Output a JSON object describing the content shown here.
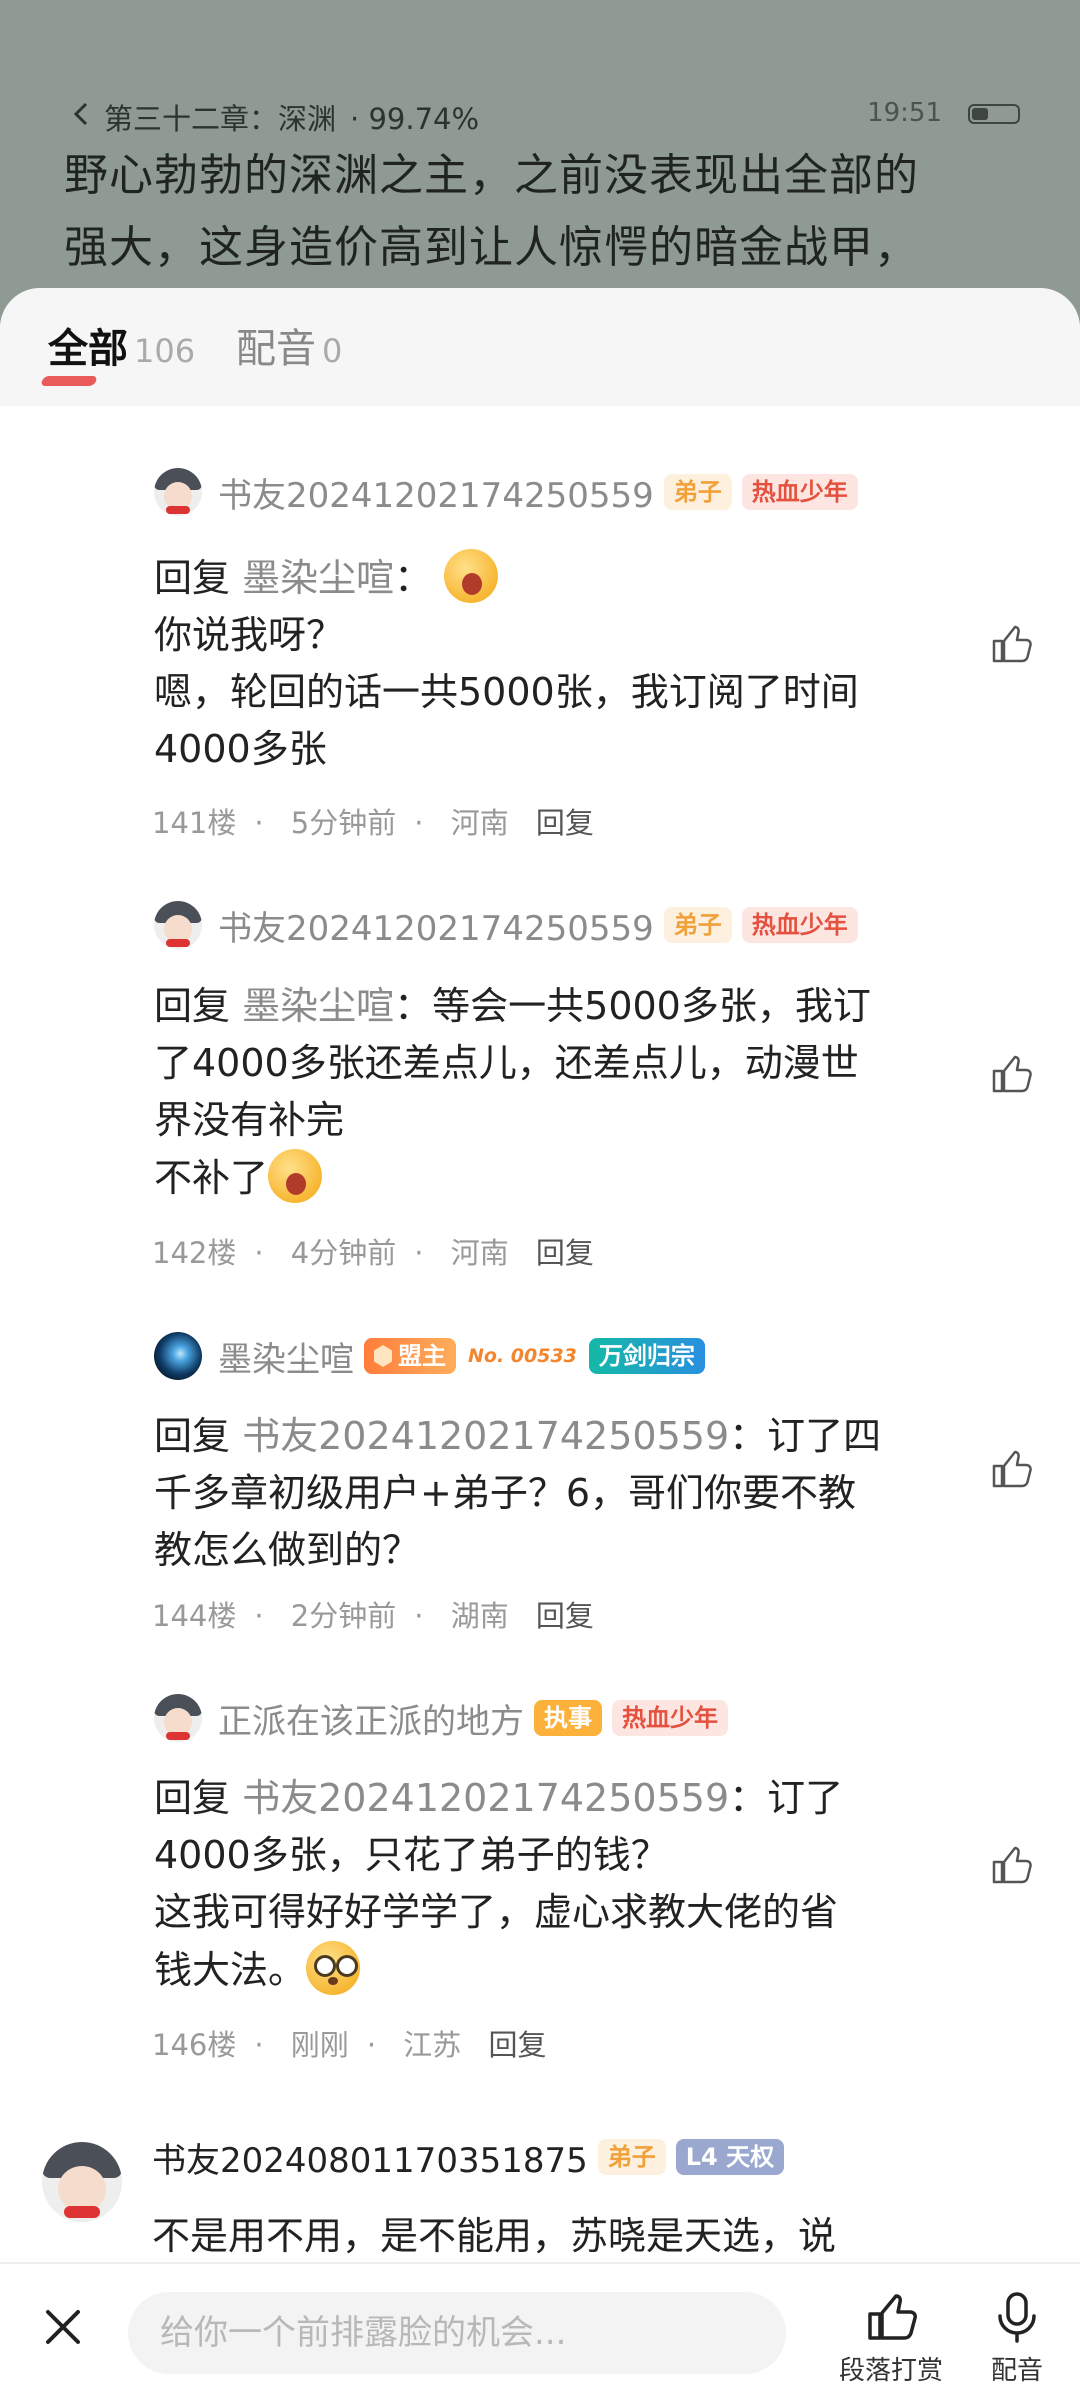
{
  "reader": {
    "chapter": "第三十二章：深渊",
    "progress": "· 99.74%",
    "time": "19:51",
    "text_lines": [
      "野心勃勃的深渊之主，之前没表现出全部的",
      "强大，这身造价高到让人惊愕的暗金战甲，"
    ]
  },
  "tabs": {
    "all_label": "全部",
    "all_count": "106",
    "dub_label": "配音",
    "dub_count": "0"
  },
  "comments": [
    {
      "user": "书友20241202174250559",
      "badges": [
        "弟子",
        "热血少年"
      ],
      "reply_prefix": "回复",
      "reply_to": "墨染尘喧",
      "sep": "：",
      "lines": [
        "你说我呀？",
        "嗯，轮回的话一共5000张，我订阅了时间",
        "4000多张"
      ],
      "floor": "141楼",
      "time": "5分钟前",
      "region": "河南",
      "reply": "回复"
    },
    {
      "user": "书友20241202174250559",
      "badges": [
        "弟子",
        "热血少年"
      ],
      "reply_prefix": "回复",
      "reply_to": "墨染尘喧",
      "sep": "：",
      "first": "等会一共5000多张，我订",
      "lines": [
        "了4000多张还差点儿，还差点儿，动漫世",
        "界没有补完",
        "不补了"
      ],
      "floor": "142楼",
      "time": "4分钟前",
      "region": "河南",
      "reply": "回复"
    },
    {
      "user": "墨染尘喧",
      "badges": [
        "盟主",
        "No. 00533",
        "万剑归宗"
      ],
      "reply_prefix": "回复",
      "reply_to": "书友20241202174250559",
      "sep": "：",
      "first": "订了四",
      "lines": [
        "千多章初级用户+弟子？6，哥们你要不教",
        "教怎么做到的？"
      ],
      "floor": "144楼",
      "time": "2分钟前",
      "region": "湖南",
      "reply": "回复"
    },
    {
      "user": "正派在该正派的地方",
      "badges": [
        "执事",
        "热血少年"
      ],
      "reply_prefix": "回复",
      "reply_to": "书友20241202174250559",
      "sep": "：",
      "first": "订了",
      "lines": [
        "4000多张，只花了弟子的钱？",
        "这我可得好好学学了，虚心求教大佬的省",
        "钱大法。"
      ],
      "floor": "146楼",
      "time": "刚刚",
      "region": "江苏",
      "reply": "回复"
    },
    {
      "user": "书友20240801170351875",
      "badges": [
        "弟子",
        "L4 天权"
      ],
      "lines": [
        "不是用不用，是不能用，苏晓是天选，说"
      ]
    }
  ],
  "bottom": {
    "placeholder": "给你一个前排露脸的机会...",
    "tip_label": "段落打赏",
    "dub_label": "配音"
  },
  "colors": {
    "accent": "#e84a4a",
    "reader_bg": "#8f9a92"
  }
}
